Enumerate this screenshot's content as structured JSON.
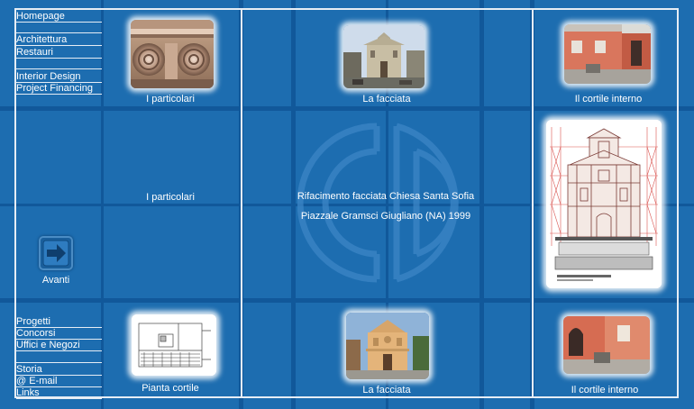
{
  "menu": {
    "top": [
      "Homepage",
      "Architettura",
      "Restauri",
      "Interior Design",
      "Project Financing"
    ],
    "bottom": [
      "Progetti",
      "Concorsi",
      "Uffici e Negozi",
      "Storia",
      "@ E-mail",
      "Links"
    ]
  },
  "captions": {
    "particolari_top": "I particolari",
    "facciata_top": "La facciata",
    "cortile_top": "Il cortile interno",
    "particolari_mid": "I particolari",
    "pianta_cortile": "Pianta cortile",
    "facciata_bottom": "La facciata",
    "cortile_bottom": "Il cortile interno"
  },
  "project": {
    "title": "Rifacimento facciata Chiesa Santa Sofia",
    "location": "Piazzale  Gramsci Giugliano  (NA)  1999"
  },
  "nav": {
    "next_label": "Avanti"
  },
  "colors": {
    "background": "#1d6db0",
    "grid_dark": "#11589a",
    "frame": "#e6edf5"
  }
}
